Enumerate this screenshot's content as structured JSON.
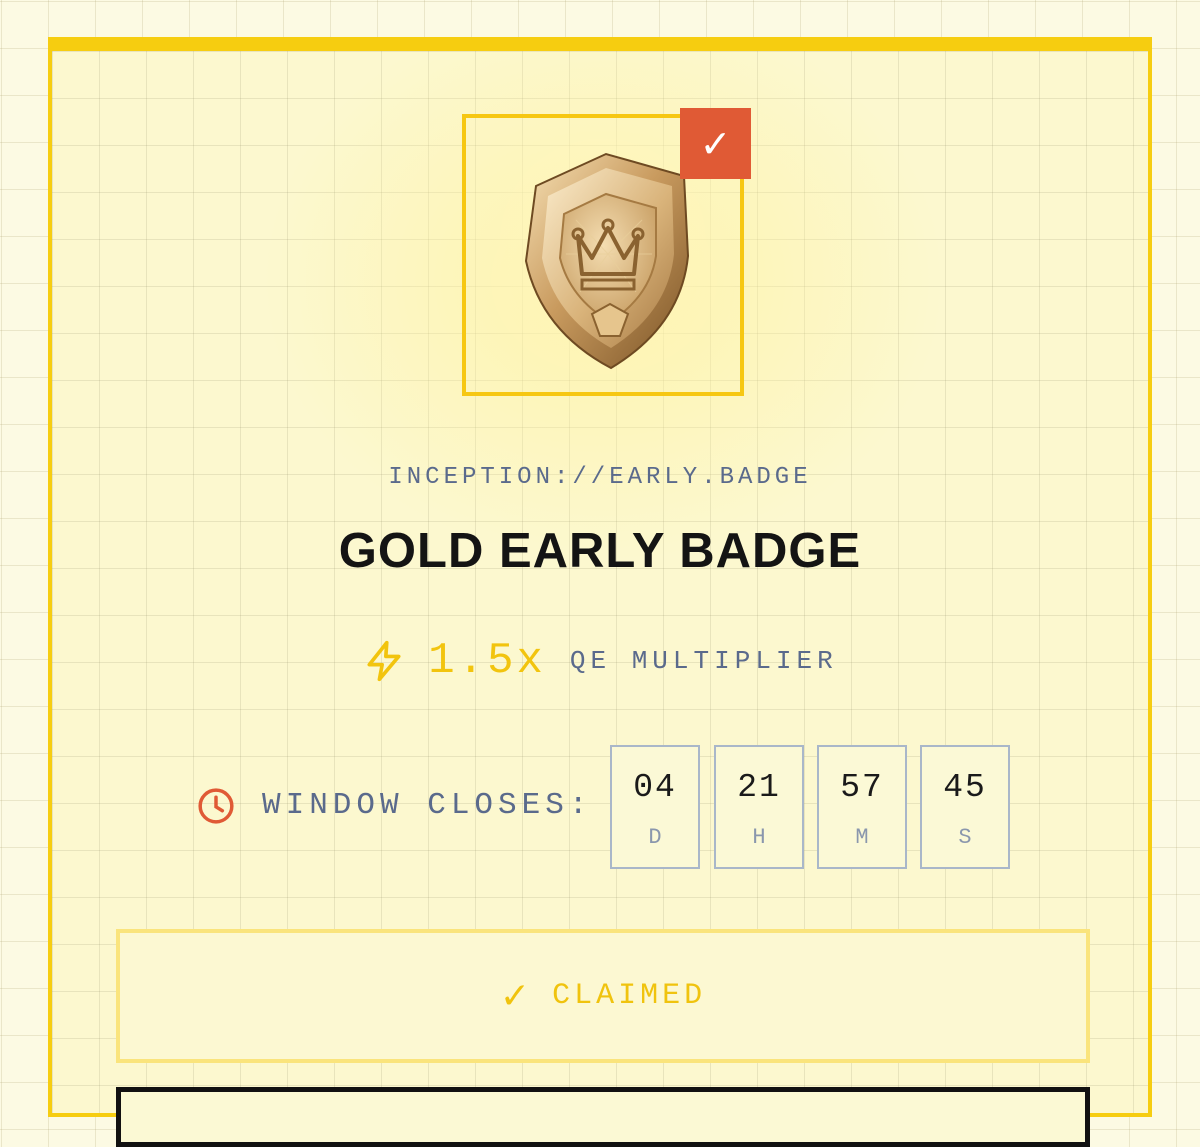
{
  "badge": {
    "image_name": "gold-shield-crown-badge",
    "check_icon": "check-icon",
    "check_glyph": "✓",
    "protocol": "INCEPTION://EARLY.BADGE",
    "title": "GOLD EARLY BADGE"
  },
  "multiplier": {
    "icon": "lightning-icon",
    "value": "1.5x",
    "label": "QE MULTIPLIER"
  },
  "countdown": {
    "icon": "clock-icon",
    "label": "WINDOW CLOSES:",
    "units": [
      {
        "value": "04",
        "unit": "D"
      },
      {
        "value": "21",
        "unit": "H"
      },
      {
        "value": "57",
        "unit": "M"
      },
      {
        "value": "45",
        "unit": "S"
      }
    ]
  },
  "claim": {
    "icon_glyph": "✓",
    "label": "CLAIMED"
  },
  "colors": {
    "accent_yellow": "#f6cd10",
    "tag_red": "#e05a35",
    "muted_blue": "#5a6a8c",
    "text_dark": "#141414",
    "background": "#fcfae3"
  }
}
